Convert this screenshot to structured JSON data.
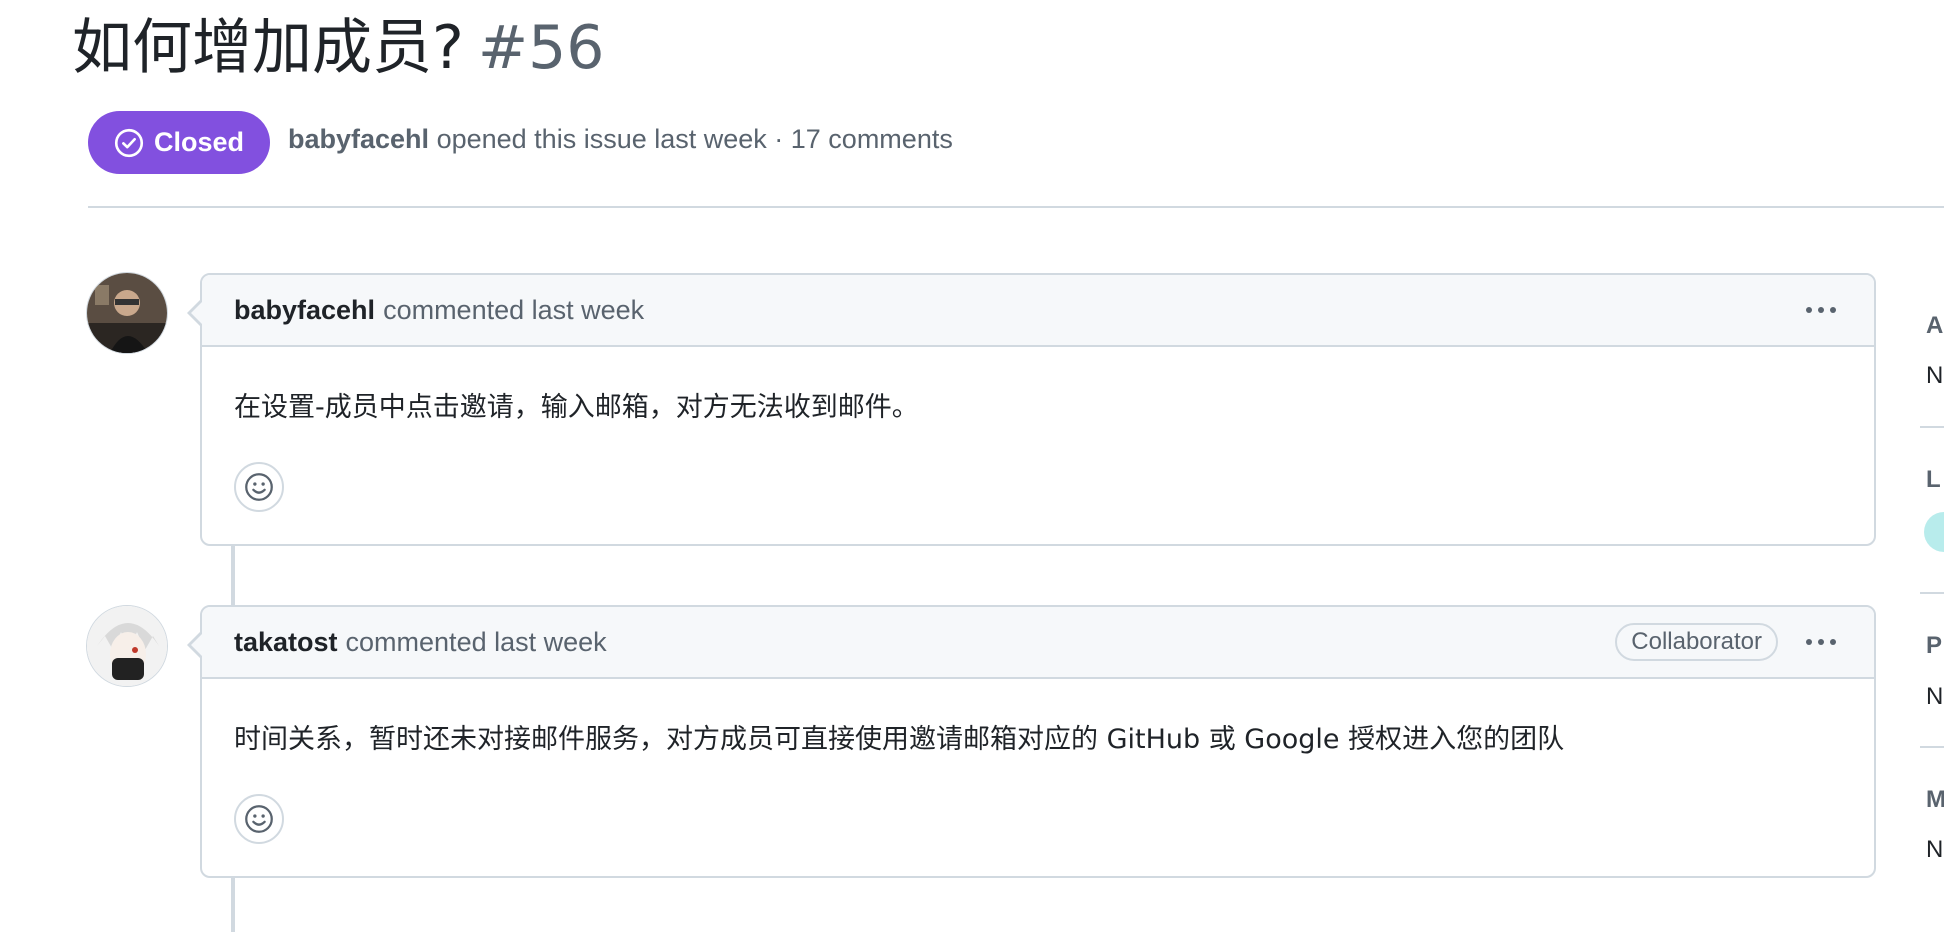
{
  "issue": {
    "title": "如何增加成员?",
    "number": "#56",
    "state": "Closed",
    "author": "babyfacehl",
    "meta_text": "opened this issue last week · 17 comments"
  },
  "comments": [
    {
      "author": "babyfacehl",
      "action": "commented last week",
      "body": "在设置-成员中点击邀请，输入邮箱，对方无法收到邮件。"
    },
    {
      "author": "takatost",
      "action": "commented last week",
      "role": "Collaborator",
      "body": "时间关系，暂时还未对接邮件服务，对方成员可直接使用邀请邮箱对应的 GitHub 或 Google 授权进入您的团队"
    }
  ],
  "sidebar": {
    "partial": [
      "A",
      "N",
      "L",
      "P",
      "N",
      "M",
      "N"
    ]
  },
  "colors": {
    "closed": "#8250df",
    "border": "#d1d9e0",
    "header_bg": "#f6f8fa",
    "muted": "#59636e",
    "label_chip": "#b8ecec"
  },
  "icons": [
    "check-circle-icon",
    "kebab-icon",
    "smiley-icon"
  ]
}
